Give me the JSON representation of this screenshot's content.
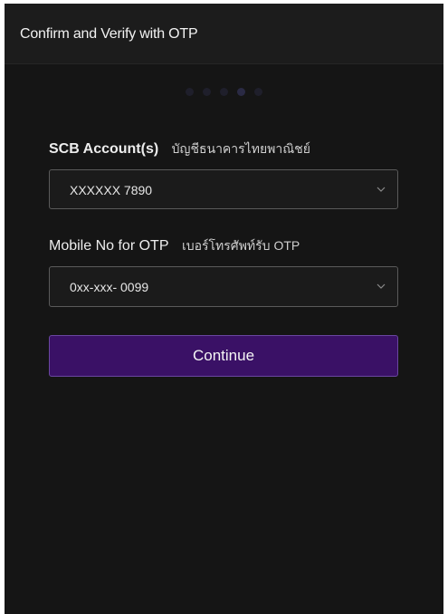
{
  "header": {
    "title": "Confirm and Verify with OTP"
  },
  "stepper": {
    "total_steps": 5,
    "current_step": 4
  },
  "account": {
    "label_en": "SCB Account(s)",
    "label_th": "บัญชีธนาคารไทยพาณิชย์",
    "selected_value": "XXXXXX 7890"
  },
  "mobile": {
    "label_en": "Mobile No for OTP",
    "label_th": "เบอร์โทรศัพท์รับ OTP",
    "selected_value": "0xx-xxx- 0099"
  },
  "actions": {
    "continue_label": "Continue"
  },
  "colors": {
    "background": "#151515",
    "header": "#1c1c1c",
    "primary_button": "#3a1166"
  }
}
